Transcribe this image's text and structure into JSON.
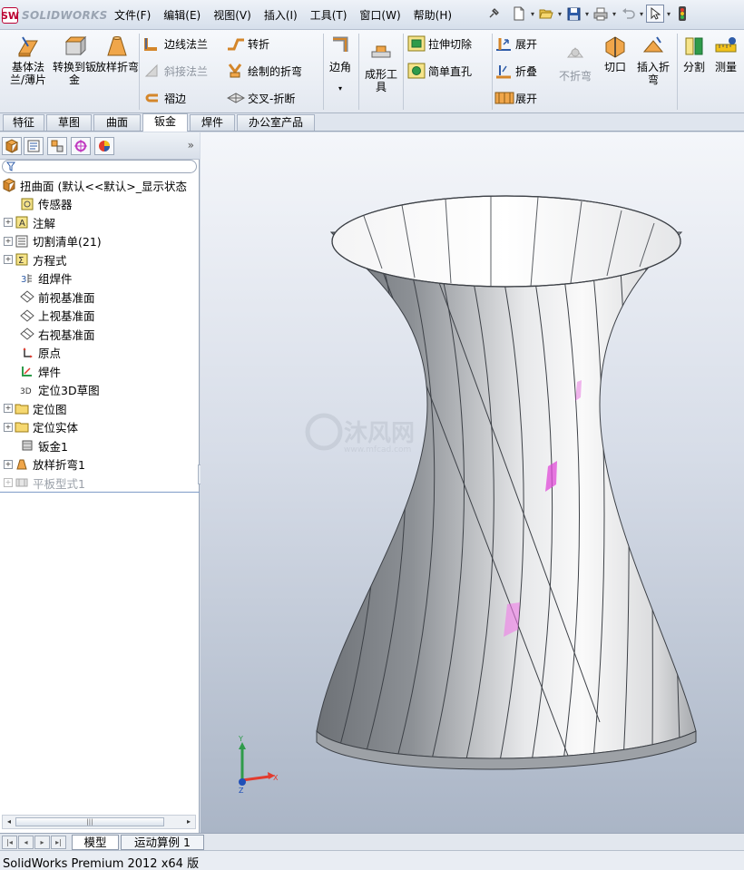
{
  "app": {
    "logo_text": "SOLIDWORKS",
    "logo_mark": "SW"
  },
  "menu": [
    "文件(F)",
    "编辑(E)",
    "视图(V)",
    "插入(I)",
    "工具(T)",
    "窗口(W)",
    "帮助(H)"
  ],
  "ribbon": {
    "big_buttons": [
      {
        "label": "基体法兰/薄片",
        "icon": "base-flange-icon"
      },
      {
        "label": "转换到钣金",
        "icon": "convert-to-sheetmetal-icon"
      },
      {
        "label": "放样折弯",
        "icon": "lofted-bend-icon"
      },
      {
        "label": "边角",
        "icon": "corner-icon"
      },
      {
        "label": "成形工具",
        "icon": "forming-tool-icon"
      },
      {
        "label": "不折弯",
        "icon": "no-bends-icon"
      },
      {
        "label": "切口",
        "icon": "rip-icon"
      },
      {
        "label": "插入折弯",
        "icon": "insert-bends-icon"
      },
      {
        "label": "分割",
        "icon": "split-icon"
      },
      {
        "label": "测量",
        "icon": "measure-icon"
      }
    ],
    "small_buttons": [
      {
        "label": "边线法兰",
        "icon": "edge-flange-icon"
      },
      {
        "label": "斜接法兰",
        "icon": "miter-flange-icon"
      },
      {
        "label": "褶边",
        "icon": "hem-icon"
      },
      {
        "label": "转折",
        "icon": "jog-icon"
      },
      {
        "label": "绘制的折弯",
        "icon": "sketched-bend-icon"
      },
      {
        "label": "交叉-折断",
        "icon": "cross-break-icon"
      },
      {
        "label": "拉伸切除",
        "icon": "extruded-cut-icon"
      },
      {
        "label": "简单直孔",
        "icon": "simple-hole-icon"
      },
      {
        "label": "展开",
        "icon": "unfold-icon"
      },
      {
        "label": "折叠",
        "icon": "fold-icon"
      },
      {
        "label": "展开",
        "icon": "flatten-icon"
      }
    ]
  },
  "command_tabs": [
    "特征",
    "草图",
    "曲面",
    "钣金",
    "焊件",
    "办公室产品"
  ],
  "active_command_tab": "钣金",
  "tree": {
    "root": "扭曲面 (默认<<默认>_显示状态",
    "items": [
      {
        "label": "传感器",
        "expandable": false,
        "icon": "sensor-icon"
      },
      {
        "label": "注解",
        "expandable": true,
        "icon": "annotation-icon"
      },
      {
        "label": "切割清单(21)",
        "expandable": true,
        "icon": "cut-list-icon"
      },
      {
        "label": "方程式",
        "expandable": true,
        "icon": "equation-icon"
      },
      {
        "label": "组焊件",
        "expandable": false,
        "icon": "weldment-group-icon"
      },
      {
        "label": "前视基准面",
        "expandable": false,
        "icon": "plane-icon"
      },
      {
        "label": "上视基准面",
        "expandable": false,
        "icon": "plane-icon"
      },
      {
        "label": "右视基准面",
        "expandable": false,
        "icon": "plane-icon"
      },
      {
        "label": "原点",
        "expandable": false,
        "icon": "origin-icon"
      },
      {
        "label": "焊件",
        "expandable": false,
        "icon": "weldment-icon"
      },
      {
        "label": "定位3D草图",
        "expandable": false,
        "icon": "3d-sketch-icon"
      },
      {
        "label": "定位图",
        "expandable": true,
        "icon": "folder-icon"
      },
      {
        "label": "定位实体",
        "expandable": true,
        "icon": "folder-icon"
      },
      {
        "label": "钣金1",
        "expandable": false,
        "icon": "sheetmetal-icon"
      },
      {
        "label": "放样折弯1",
        "expandable": true,
        "icon": "lofted-bend-icon"
      },
      {
        "label": "平板型式1",
        "expandable": true,
        "icon": "flat-pattern-icon",
        "suppressed": true
      }
    ]
  },
  "viewport": {
    "watermark_main": "沐风网",
    "watermark_sub": "www.mfcad.com",
    "triad": {
      "x": "X",
      "y": "Y",
      "z": "Z"
    }
  },
  "bottom_tabs": [
    "模型",
    "运动算例 1"
  ],
  "active_bottom_tab": "模型",
  "status": "SolidWorks Premium 2012 x64 版"
}
